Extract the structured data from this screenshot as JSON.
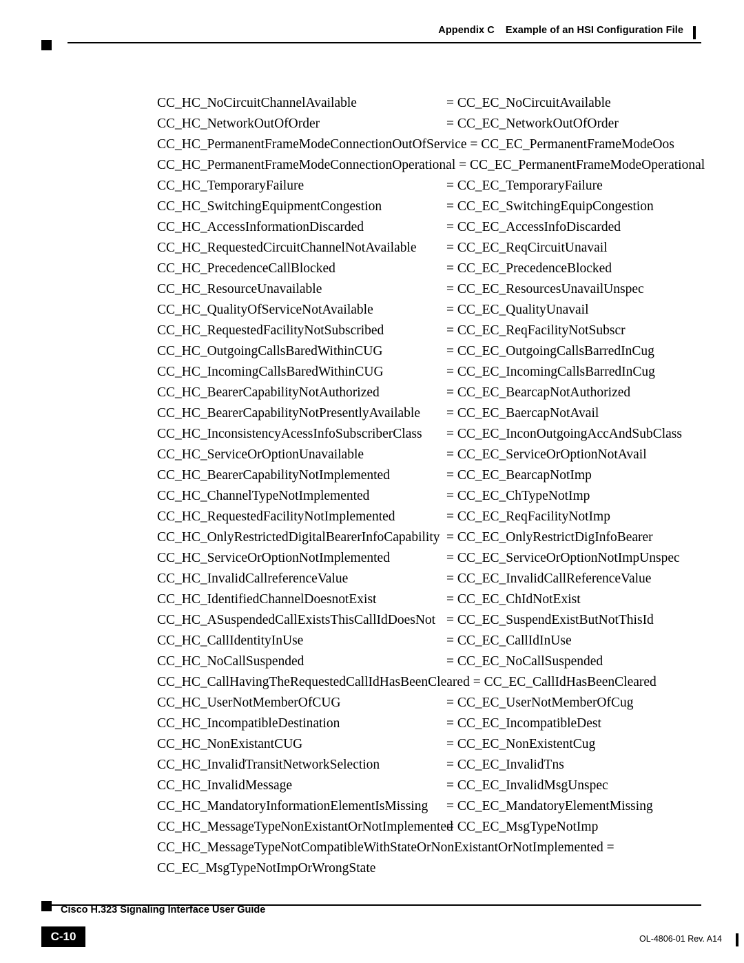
{
  "header": {
    "appendix_label": "Appendix C",
    "title": "Example of an HSI Configuration File"
  },
  "footer": {
    "guide_title": "Cisco H.323 Signaling Interface User Guide",
    "page_number": "C-10",
    "doc_id": "OL-4806-01 Rev. A14"
  },
  "mappings": [
    {
      "left": "CC_HC_NoCircuitChannelAvailable",
      "right": "= CC_EC_NoCircuitAvailable",
      "wide": false
    },
    {
      "left": "CC_HC_NetworkOutOfOrder",
      "right": "= CC_EC_NetworkOutOfOrder",
      "wide": false
    },
    {
      "left": "CC_HC_PermanentFrameModeConnectionOutOfService",
      "right": "= CC_EC_PermanentFrameModeOos",
      "wide": true
    },
    {
      "left": "CC_HC_PermanentFrameModeConnectionOperational",
      "right": "= CC_EC_PermanentFrameModeOperational",
      "wide": true
    },
    {
      "left": "CC_HC_TemporaryFailure",
      "right": "= CC_EC_TemporaryFailure",
      "wide": false
    },
    {
      "left": "CC_HC_SwitchingEquipmentCongestion",
      "right": "= CC_EC_SwitchingEquipCongestion",
      "wide": false
    },
    {
      "left": "CC_HC_AccessInformationDiscarded",
      "right": "= CC_EC_AccessInfoDiscarded",
      "wide": false
    },
    {
      "left": "CC_HC_RequestedCircuitChannelNotAvailable",
      "right": "= CC_EC_ReqCircuitUnavail",
      "wide": false
    },
    {
      "left": "CC_HC_PrecedenceCallBlocked",
      "right": "= CC_EC_PrecedenceBlocked",
      "wide": false
    },
    {
      "left": "CC_HC_ResourceUnavailable",
      "right": "= CC_EC_ResourcesUnavailUnspec",
      "wide": false
    },
    {
      "left": "CC_HC_QualityOfServiceNotAvailable",
      "right": "= CC_EC_QualityUnavail",
      "wide": false
    },
    {
      "left": "CC_HC_RequestedFacilityNotSubscribed",
      "right": "= CC_EC_ReqFacilityNotSubscr",
      "wide": false
    },
    {
      "left": "CC_HC_OutgoingCallsBaredWithinCUG",
      "right": "= CC_EC_OutgoingCallsBarredInCug",
      "wide": false
    },
    {
      "left": "CC_HC_IncomingCallsBaredWithinCUG",
      "right": "= CC_EC_IncomingCallsBarredInCug",
      "wide": false
    },
    {
      "left": "CC_HC_BearerCapabilityNotAuthorized",
      "right": "= CC_EC_BearcapNotAuthorized",
      "wide": false
    },
    {
      "left": "CC_HC_BearerCapabilityNotPresentlyAvailable",
      "right": "= CC_EC_BaercapNotAvail",
      "wide": false
    },
    {
      "left": "CC_HC_InconsistencyAcessInfoSubscriberClass",
      "right": "= CC_EC_InconOutgoingAccAndSubClass",
      "wide": false
    },
    {
      "left": "CC_HC_ServiceOrOptionUnavailable",
      "right": "= CC_EC_ServiceOrOptionNotAvail",
      "wide": false
    },
    {
      "left": "CC_HC_BearerCapabilityNotImplemented",
      "right": "= CC_EC_BearcapNotImp",
      "wide": false
    },
    {
      "left": "CC_HC_ChannelTypeNotImplemented",
      "right": "= CC_EC_ChTypeNotImp",
      "wide": false
    },
    {
      "left": "CC_HC_RequestedFacilityNotImplemented",
      "right": "= CC_EC_ReqFacilityNotImp",
      "wide": false
    },
    {
      "left": "CC_HC_OnlyRestrictedDigitalBearerInfoCapability",
      "right": "= CC_EC_OnlyRestrictDigInfoBearer",
      "wide": false
    },
    {
      "left": "CC_HC_ServiceOrOptionNotImplemented",
      "right": "= CC_EC_ServiceOrOptionNotImpUnspec",
      "wide": false
    },
    {
      "left": "CC_HC_InvalidCallreferenceValue",
      "right": "= CC_EC_InvalidCallReferenceValue",
      "wide": false
    },
    {
      "left": "CC_HC_IdentifiedChannelDoesnotExist",
      "right": "= CC_EC_ChIdNotExist",
      "wide": false
    },
    {
      "left": "CC_HC_ASuspendedCallExistsThisCallIdDoesNot",
      "right": "= CC_EC_SuspendExistButNotThisId",
      "wide": false
    },
    {
      "left": "CC_HC_CallIdentityInUse",
      "right": "= CC_EC_CallIdInUse",
      "wide": false
    },
    {
      "left": "CC_HC_NoCallSuspended",
      "right": "= CC_EC_NoCallSuspended",
      "wide": false
    },
    {
      "left": "CC_HC_CallHavingTheRequestedCallIdHasBeenCleared",
      "right": "= CC_EC_CallIdHasBeenCleared",
      "wide": true
    },
    {
      "left": "CC_HC_UserNotMemberOfCUG",
      "right": "= CC_EC_UserNotMemberOfCug",
      "wide": false
    },
    {
      "left": "CC_HC_IncompatibleDestination",
      "right": "= CC_EC_IncompatibleDest",
      "wide": false
    },
    {
      "left": "CC_HC_NonExistantCUG",
      "right": "= CC_EC_NonExistentCug",
      "wide": false
    },
    {
      "left": "CC_HC_InvalidTransitNetworkSelection",
      "right": "= CC_EC_InvalidTns",
      "wide": false
    },
    {
      "left": "CC_HC_InvalidMessage",
      "right": "= CC_EC_InvalidMsgUnspec",
      "wide": false
    },
    {
      "left": "CC_HC_MandatoryInformationElementIsMissing",
      "right": "= CC_EC_MandatoryElementMissing",
      "wide": false
    },
    {
      "left": "CC_HC_MessageTypeNonExistantOrNotImplemented",
      "right": "= CC_EC_MsgTypeNotImp",
      "wide": false
    }
  ],
  "final_entry": {
    "line1": "CC_HC_MessageTypeNotCompatibleWithStateOrNonExistantOrNotImplemented =",
    "line2": "CC_EC_MsgTypeNotImpOrWrongState"
  }
}
